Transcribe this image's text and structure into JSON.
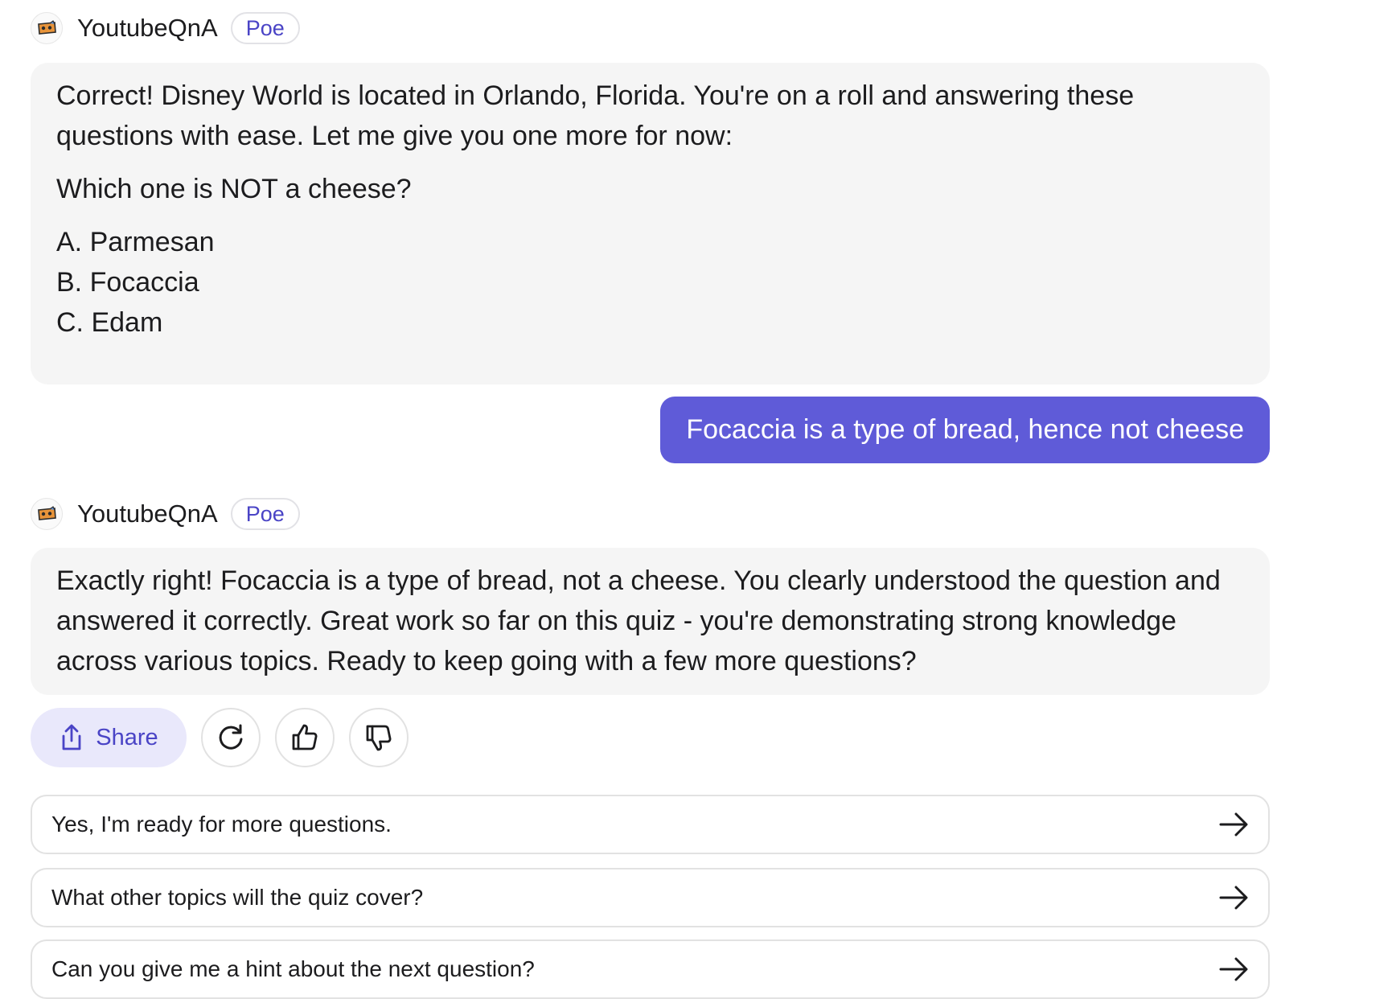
{
  "messages": [
    {
      "bot_name": "YoutubeQnA",
      "badge": "Poe",
      "paragraphs": [
        "Correct! Disney World is located in Orlando, Florida. You're on a roll and answering these questions with ease. Let me give you one more for now:",
        "Which one is NOT a cheese?"
      ],
      "options": [
        "A. Parmesan",
        "B. Focaccia",
        "C. Edam"
      ]
    },
    {
      "user_text": "Focaccia is a type of bread, hence not cheese"
    },
    {
      "bot_name": "YoutubeQnA",
      "badge": "Poe",
      "paragraphs": [
        "Exactly right! Focaccia is a type of bread, not a cheese. You clearly understood the question and answered it correctly. Great work so far on this quiz - you're demonstrating strong knowledge across various topics. Ready to keep going with a few more questions?"
      ]
    }
  ],
  "actions": {
    "share_label": "Share",
    "icons": [
      "share-icon",
      "retry-icon",
      "thumbs-up-icon",
      "thumbs-down-icon"
    ]
  },
  "suggestions": [
    "Yes, I'm ready for more questions.",
    "What other topics will the quiz cover?",
    "Can you give me a hint about the next question?"
  ],
  "colors": {
    "accent": "#5f5bd8",
    "accent_text": "#4a44c6",
    "bot_bubble": "#f5f5f5",
    "share_bg": "#e9e8fb"
  }
}
